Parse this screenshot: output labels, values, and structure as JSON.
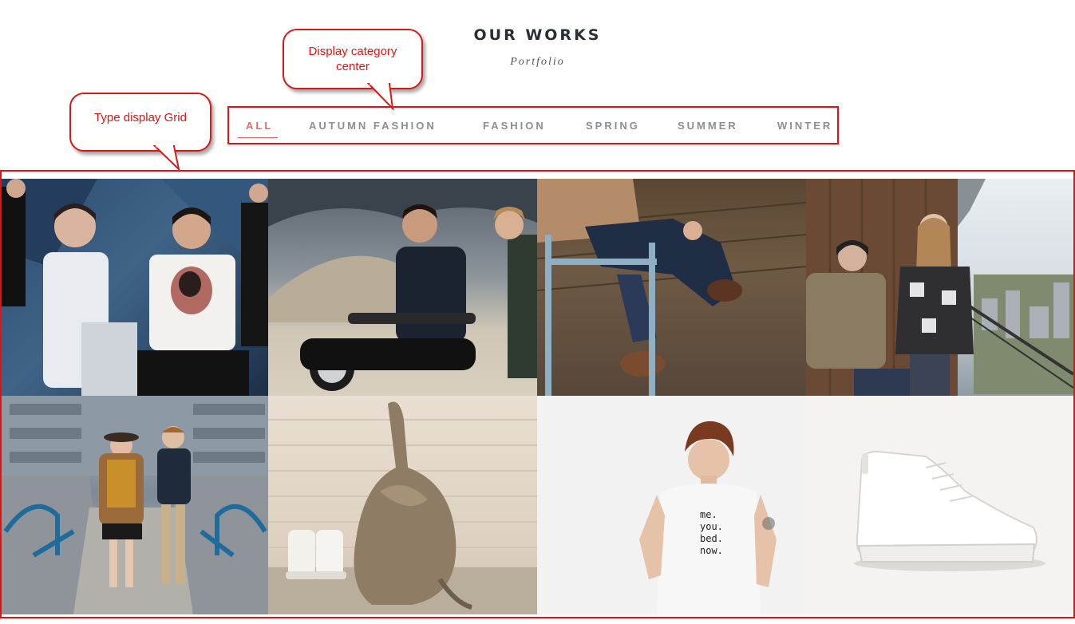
{
  "header": {
    "title": "OUR WORKS",
    "subtitle": "Portfolio"
  },
  "categories": [
    {
      "label": "ALL",
      "active": true
    },
    {
      "label": "AUTUMN FASHION",
      "active": false
    },
    {
      "label": "FASHION",
      "active": false
    },
    {
      "label": "SPRING",
      "active": false
    },
    {
      "label": "SUMMER",
      "active": false
    },
    {
      "label": "WINTER",
      "active": false
    }
  ],
  "annotations": {
    "category_callout": "Display category center",
    "grid_callout": "Type display Grid"
  },
  "portfolio": {
    "items": [
      {
        "subject": "models in white and black outfits"
      },
      {
        "subject": "couple with motorcycle"
      },
      {
        "subject": "person seated on stool in jeans"
      },
      {
        "subject": "couple on balcony"
      },
      {
        "subject": "couple standing in walkway"
      },
      {
        "subject": "canvas sack and white sneakers"
      },
      {
        "subject": "man in printed white t-shirt",
        "print_text": [
          "me.",
          "you.",
          "bed.",
          "now."
        ]
      },
      {
        "subject": "white high-top sneaker"
      }
    ]
  },
  "colors": {
    "accent": "#e8686a",
    "annotation": "#e01414",
    "category_text": "#8a8f94"
  }
}
